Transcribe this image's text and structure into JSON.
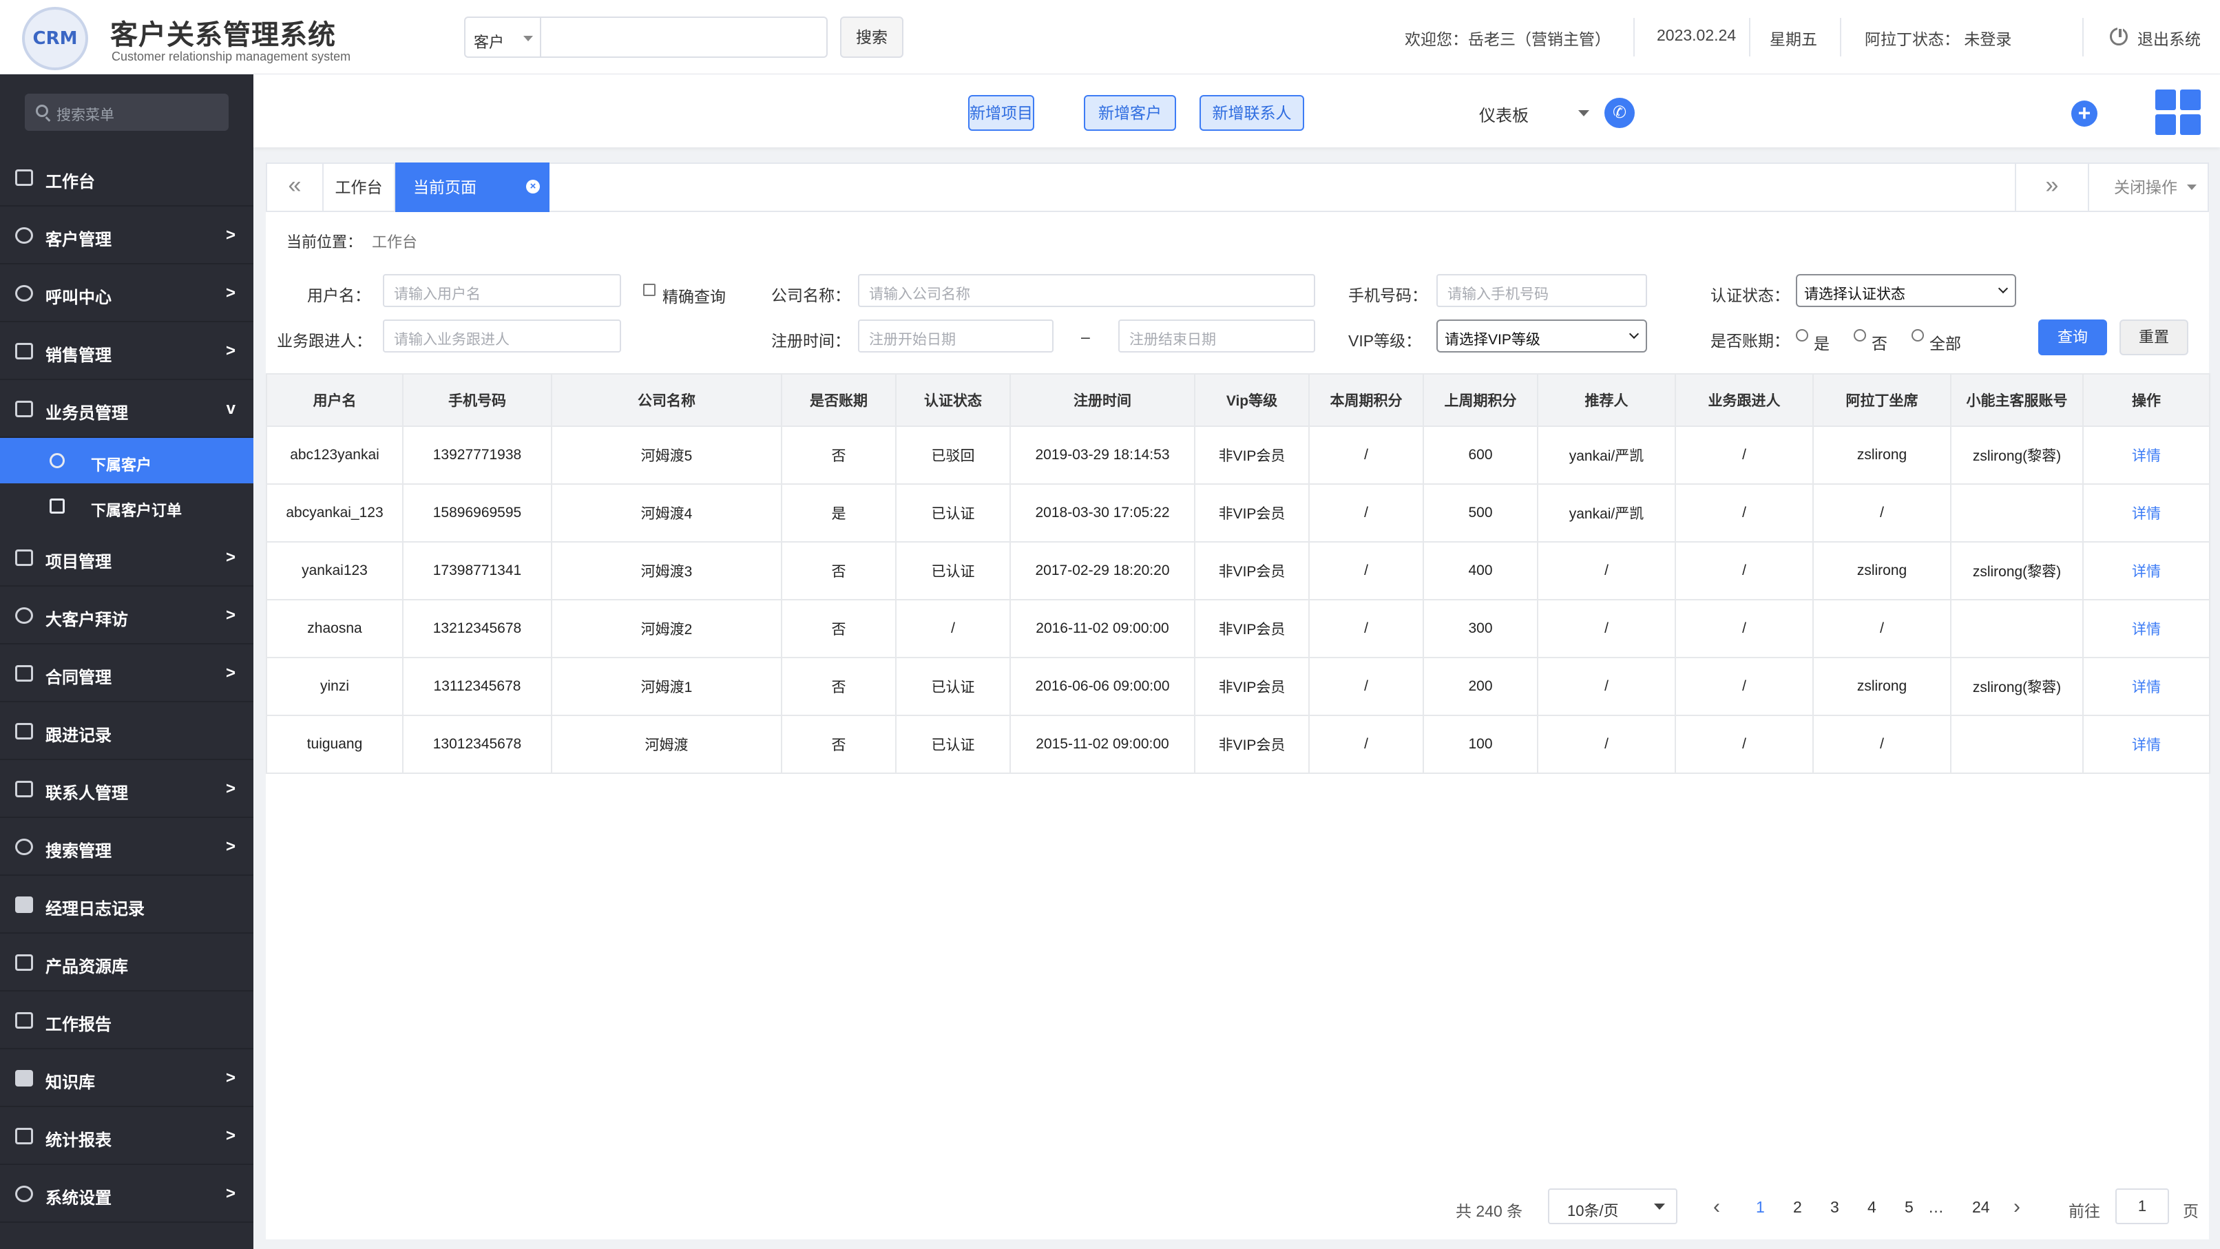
{
  "app": {
    "logo_text": "CRM",
    "title": "客户关系管理系统",
    "subtitle": "Customer relationship management system"
  },
  "header": {
    "search_type": "客户",
    "search_button": "搜索",
    "welcome": "欢迎您：岳老三（营销主管）",
    "date": "2023.02.24",
    "weekday": "星期五",
    "aladdin_status": "阿拉丁状态：  未登录",
    "logout": "退出系统"
  },
  "toolbar": {
    "dashboard": "仪表板",
    "new_project": "新增项目",
    "new_customer": "新增客户",
    "new_contact": "新增联系人",
    "plus": "+"
  },
  "sidebar": {
    "search_placeholder": "搜索菜单",
    "items": [
      {
        "label": "工作台",
        "arrow": ""
      },
      {
        "label": "客户管理",
        "arrow": ">"
      },
      {
        "label": "呼叫中心",
        "arrow": ">"
      },
      {
        "label": "销售管理",
        "arrow": ">"
      },
      {
        "label": "业务员管理",
        "arrow": "v"
      },
      {
        "label": "项目管理",
        "arrow": ">"
      },
      {
        "label": "大客户拜访",
        "arrow": ">"
      },
      {
        "label": "合同管理",
        "arrow": ">"
      },
      {
        "label": "跟进记录",
        "arrow": ""
      },
      {
        "label": "联系人管理",
        "arrow": ">"
      },
      {
        "label": "搜索管理",
        "arrow": ">"
      },
      {
        "label": "经理日志记录",
        "arrow": ""
      },
      {
        "label": "产品资源库",
        "arrow": ""
      },
      {
        "label": "工作报告",
        "arrow": ""
      },
      {
        "label": "知识库",
        "arrow": ">"
      },
      {
        "label": "统计报表",
        "arrow": ">"
      },
      {
        "label": "系统设置",
        "arrow": ">"
      }
    ],
    "sub_items": [
      {
        "label": "下属客户"
      },
      {
        "label": "下属客户订单"
      }
    ]
  },
  "tabs": {
    "prev": "«",
    "home": "工作台",
    "current": "当前页面",
    "close": "×",
    "next": "»",
    "ops": "关闭操作"
  },
  "breadcrumb": {
    "label": "当前位置：",
    "value": "工作台"
  },
  "filters": {
    "username_label": "用户名：",
    "username_placeholder": "请输入用户名",
    "exact_query": "精确查询",
    "company_label": "公司名称：",
    "company_placeholder": "请输入公司名称",
    "phone_label": "手机号码：",
    "phone_placeholder": "请输入手机号码",
    "auth_label": "认证状态：",
    "auth_value": "请选择认证状态",
    "follower_label": "业务跟进人：",
    "follower_placeholder": "请输入业务跟进人",
    "regtime_label": "注册时间：",
    "start_placeholder": "注册开始日期",
    "dash": "–",
    "end_placeholder": "注册结束日期",
    "vip_label": "VIP等级：",
    "vip_value": "请选择VIP等级",
    "account_label": "是否账期：",
    "radio_yes": "是",
    "radio_no": "否",
    "radio_all": "全部",
    "query_button": "查询",
    "reset_button": "重置"
  },
  "table": {
    "headers": [
      "用户名",
      "手机号码",
      "公司名称",
      "是否账期",
      "认证状态",
      "注册时间",
      "Vip等级",
      "本周期积分",
      "上周期积分",
      "推荐人",
      "业务跟进人",
      "阿拉丁坐席",
      "小能主客服账号",
      "操作"
    ],
    "rows": [
      [
        "abc123yankai",
        "13927771938",
        "河姆渡5",
        "否",
        "已驳回",
        "2019-03-29 18:14:53",
        "非VIP会员",
        "/",
        "600",
        "yankai/严凯",
        "/",
        "zslirong",
        "zslirong(黎蓉)",
        "详情"
      ],
      [
        "abcyankai_123",
        "15896969595",
        "河姆渡4",
        "是",
        "已认证",
        "2018-03-30 17:05:22",
        "非VIP会员",
        "/",
        "500",
        "yankai/严凯",
        "/",
        "/",
        "",
        "详情"
      ],
      [
        "yankai123",
        "17398771341",
        "河姆渡3",
        "否",
        "已认证",
        "2017-02-29 18:20:20",
        "非VIP会员",
        "/",
        "400",
        "/",
        "/",
        "zslirong",
        "zslirong(黎蓉)",
        "详情"
      ],
      [
        "zhaosna",
        "13212345678",
        "河姆渡2",
        "否",
        "/",
        "2016-11-02 09:00:00",
        "非VIP会员",
        "/",
        "300",
        "/",
        "/",
        "/",
        "",
        "详情"
      ],
      [
        "yinzi",
        "13112345678",
        "河姆渡1",
        "否",
        "已认证",
        "2016-06-06 09:00:00",
        "非VIP会员",
        "/",
        "200",
        "/",
        "/",
        "zslirong",
        "zslirong(黎蓉)",
        "详情"
      ],
      [
        "tuiguang",
        "13012345678",
        "河姆渡",
        "否",
        "已认证",
        "2015-11-02 09:00:00",
        "非VIP会员",
        "/",
        "100",
        "/",
        "/",
        "/",
        "",
        "详情"
      ]
    ]
  },
  "pagination": {
    "total": "共 240 条",
    "page_size": "10条/页",
    "prev": "‹",
    "pages": [
      "1",
      "2",
      "3",
      "4",
      "5",
      "…",
      "24"
    ],
    "next": "›",
    "goto_label": "前往",
    "goto_value": "1",
    "page_unit": "页"
  },
  "colors": {
    "accent": "#3d7cf5",
    "sidebar_bg": "#2a2c34"
  }
}
